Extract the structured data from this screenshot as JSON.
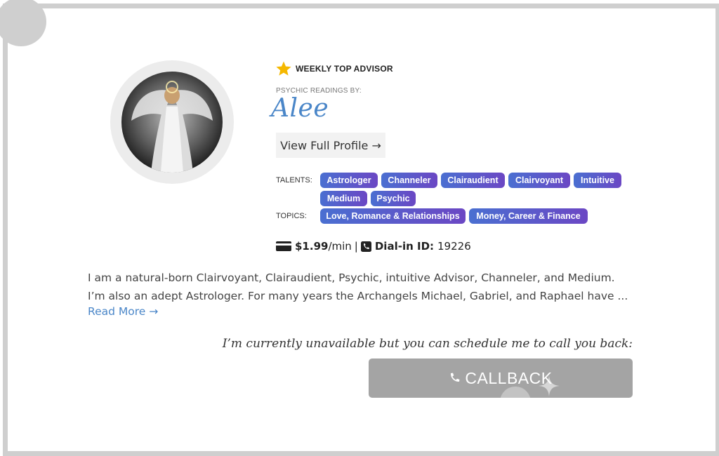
{
  "badge": {
    "text": "WEEKLY TOP ADVISOR",
    "icon": "star-icon",
    "color": "#f5b800"
  },
  "advisor": {
    "by_label": "PSYCHIC READINGS BY:",
    "name": "Alee",
    "profile_button": "View Full Profile →"
  },
  "talents": {
    "label": "TALENTS:",
    "items": [
      "Astrologer",
      "Channeler",
      "Clairaudient",
      "Clairvoyant",
      "Intuitive",
      "Medium",
      "Psychic"
    ]
  },
  "topics": {
    "label": "TOPICS:",
    "items": [
      "Love, Romance & Relationships",
      "Money, Career & Finance"
    ]
  },
  "rate": {
    "price": "$1.99",
    "unit": "/min",
    "separator": "|",
    "dial_label": "Dial-in ID:",
    "dial_id": "19226"
  },
  "bio": {
    "text": "I am a natural-born Clairvoyant, Clairaudient, Psychic, intuitive Advisor, Channeler, and Medium. I’m also an adept Astrologer. For many years the Archangels Michael, Gabriel, and Raphael have ...",
    "read_more": "Read More →"
  },
  "callback": {
    "message": "I’m currently unavailable but you can schedule me to call you back:",
    "button_label": "CALLBACK"
  },
  "colors": {
    "accent": "#4a86c8",
    "tag_gradient_start": "#4a6fd1",
    "tag_gradient_end": "#6b47c4",
    "button_gray": "#a4a4a4"
  }
}
